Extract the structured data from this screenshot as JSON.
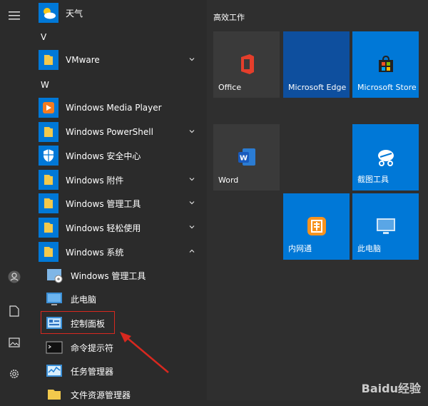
{
  "apps": {
    "weather": "天气",
    "letter_v": "V",
    "vmware": "VMware",
    "letter_w": "W",
    "wmp": "Windows Media Player",
    "powershell": "Windows PowerShell",
    "security": "Windows 安全中心",
    "accessories": "Windows 附件",
    "admin_tools": "Windows 管理工具",
    "ease_access": "Windows 轻松使用",
    "system": "Windows 系统",
    "sub_admin_tools": "Windows 管理工具",
    "this_pc": "此电脑",
    "control_panel": "控制面板",
    "cmd": "命令提示符",
    "task_manager": "任务管理器",
    "explorer": "文件资源管理器"
  },
  "tiles": {
    "group_title": "高效工作",
    "office": "Office",
    "edge": "Microsoft Edge",
    "store": "Microsoft Store",
    "word": "Word",
    "snip": "截图工具",
    "intranet": "内网通",
    "this_pc": "此电脑"
  },
  "colors": {
    "accent": "#0078d7",
    "folder": "#f2c94c",
    "highlight": "#d8281f"
  },
  "watermark": "Baidu经验"
}
